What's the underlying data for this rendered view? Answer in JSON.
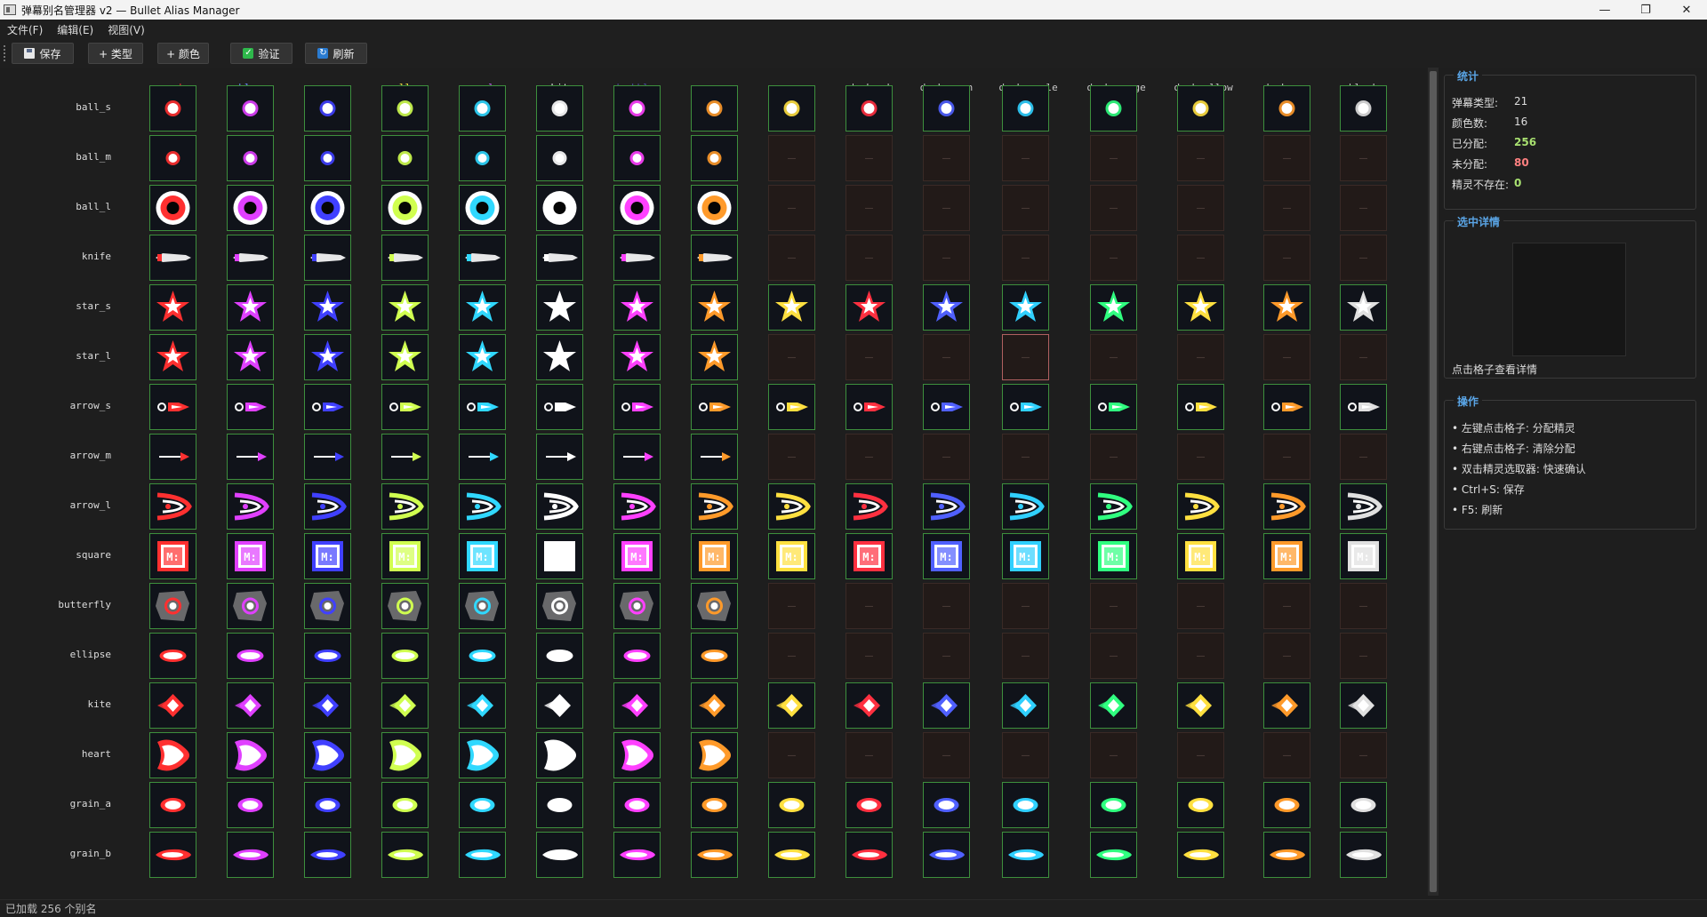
{
  "window": {
    "title": "弹幕别名管理器 v2 — Bullet Alias Manager",
    "minimize": "—",
    "maximize": "❐",
    "close": "✕"
  },
  "menu": [
    "文件(F)",
    "编辑(E)",
    "视图(V)"
  ],
  "toolbar": {
    "save": "保存",
    "add_type": "+ 类型",
    "add_color": "+ 颜色",
    "validate": "验证",
    "refresh": "刷新"
  },
  "colors": [
    {
      "name": "red",
      "hex": "#ff3030"
    },
    {
      "name": "blue",
      "hex": "#6a8cff"
    },
    {
      "name": "green",
      "hex": "#5fd45f"
    },
    {
      "name": "yellow",
      "hex": "#f2e040"
    },
    {
      "name": "purple",
      "hex": "#c060f0"
    },
    {
      "name": "white",
      "hex": "#f0f0f0"
    },
    {
      "name": "darkblue",
      "hex": "#4a4aa0"
    },
    {
      "name": "orange",
      "hex": "#ff9a2a"
    },
    {
      "name": "cyan",
      "hex": "#40e0f0"
    },
    {
      "name": "darkred",
      "hex": "#c8c8c8"
    },
    {
      "name": "darkgreen",
      "hex": "#c8c8c8"
    },
    {
      "name": "darkpurple",
      "hex": "#c8c8c8"
    },
    {
      "name": "darkorange",
      "hex": "#c8c8c8"
    },
    {
      "name": "darkyellow",
      "hex": "#c8c8c8"
    },
    {
      "name": "darkcyan",
      "hex": "#c8c8c8"
    },
    {
      "name": "black",
      "hex": "#c8c8c8"
    }
  ],
  "sprite_colors": [
    "#ff3030",
    "#e040ff",
    "#4040ff",
    "#d0ff50",
    "#30d8ff",
    "#ffffff",
    "#ff40ff",
    "#ff9a2a",
    "#ffe040",
    "#ff3040",
    "#5060ff",
    "#30d0ff",
    "#30ff80",
    "#ffe040",
    "#ff9a2a",
    "#e0e0e0"
  ],
  "rows": [
    {
      "name": "ball_s",
      "shape": "ball",
      "filled": 16
    },
    {
      "name": "ball_m",
      "shape": "ball",
      "filled": 8
    },
    {
      "name": "ball_l",
      "shape": "ring",
      "filled": 8
    },
    {
      "name": "knife",
      "shape": "knife",
      "filled": 8
    },
    {
      "name": "star_s",
      "shape": "star",
      "filled": 16
    },
    {
      "name": "star_l",
      "shape": "star",
      "filled": 8
    },
    {
      "name": "arrow_s",
      "shape": "arrow",
      "filled": 16
    },
    {
      "name": "arrow_m",
      "shape": "arrowthin",
      "filled": 8
    },
    {
      "name": "arrow_l",
      "shape": "chevron",
      "filled": 16
    },
    {
      "name": "square",
      "shape": "square",
      "filled": 16
    },
    {
      "name": "butterfly",
      "shape": "butterfly",
      "filled": 8
    },
    {
      "name": "ellipse",
      "shape": "ellipse",
      "filled": 8
    },
    {
      "name": "kite",
      "shape": "kite",
      "filled": 16
    },
    {
      "name": "heart",
      "shape": "heart",
      "filled": 8
    },
    {
      "name": "grain_a",
      "shape": "grain",
      "filled": 16
    },
    {
      "name": "grain_b",
      "shape": "grainb",
      "filled": 16
    }
  ],
  "empty_mark": "—",
  "selected_cell": {
    "row": "star_l",
    "color": "darkpurple"
  },
  "stats": {
    "title": "统计",
    "types_label": "弹幕类型:",
    "types": "21",
    "colors_label": "颜色数:",
    "colors": "16",
    "assigned_label": "已分配:",
    "assigned": "256",
    "unassigned_label": "未分配:",
    "unassigned": "80",
    "missing_label": "精灵不存在:",
    "missing": "0",
    "assigned_color": "#a8e070",
    "unassigned_color": "#ff8080",
    "missing_color": "#a8e070"
  },
  "detail": {
    "title": "选中详情",
    "hint": "点击格子查看详情"
  },
  "ops": {
    "title": "操作",
    "lines": [
      "• 左键点击格子: 分配精灵",
      "• 右键点击格子: 清除分配",
      "• 双击精灵选取器: 快速确认",
      "• Ctrl+S: 保存",
      "• F5: 刷新"
    ]
  },
  "status": "已加载 256 个别名"
}
